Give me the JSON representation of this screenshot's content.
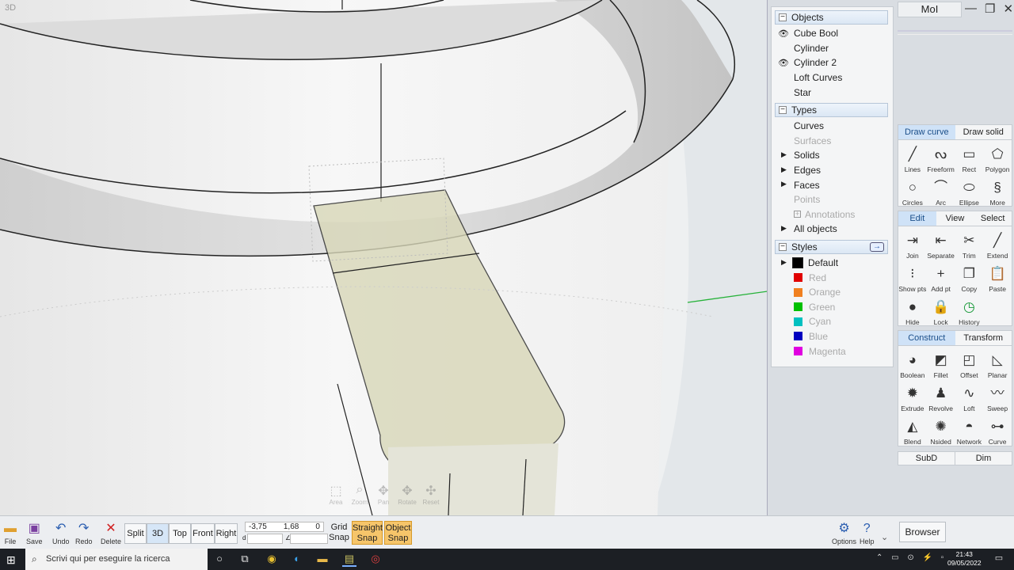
{
  "viewport": {
    "label": "3D",
    "nav_buttons": [
      "Area",
      "Zoom",
      "Pan",
      "Rotate",
      "Reset"
    ]
  },
  "scene": {
    "objects_header": "Objects",
    "objects": [
      {
        "name": "Cube Bool",
        "visible": true
      },
      {
        "name": "Cylinder",
        "visible": false
      },
      {
        "name": "Cylinder 2",
        "visible": true
      },
      {
        "name": "Loft Curves",
        "visible": false
      },
      {
        "name": "Star",
        "visible": false
      }
    ],
    "types_header": "Types",
    "types": [
      "Curves",
      "Surfaces",
      "Solids",
      "Edges",
      "Faces",
      "Points",
      "Annotations",
      "All objects"
    ],
    "styles_header": "Styles",
    "styles": [
      {
        "name": "Default",
        "color": "#000000"
      },
      {
        "name": "Red",
        "color": "#e00000"
      },
      {
        "name": "Orange",
        "color": "#f08020"
      },
      {
        "name": "Green",
        "color": "#00c000"
      },
      {
        "name": "Cyan",
        "color": "#00c0c0"
      },
      {
        "name": "Blue",
        "color": "#0000c0"
      },
      {
        "name": "Magenta",
        "color": "#e000e0"
      }
    ]
  },
  "app": {
    "title": "MoI",
    "min_icon": "minimize-icon",
    "max_icon": "restore-icon",
    "close_icon": "close-icon"
  },
  "draw": {
    "tabs": [
      "Draw curve",
      "Draw solid"
    ],
    "tools": [
      "Lines",
      "Freeform",
      "Rect",
      "Polygon",
      "Circles",
      "Arc",
      "Ellipse",
      "More"
    ]
  },
  "edit": {
    "tabs": [
      "Edit",
      "View",
      "Select"
    ],
    "tools": [
      "Join",
      "Separate",
      "Trim",
      "Extend",
      "Show pts",
      "Add pt",
      "Copy",
      "Paste",
      "Hide",
      "Lock",
      "History"
    ]
  },
  "construct": {
    "tabs": [
      "Construct",
      "Transform"
    ],
    "tools": [
      "Boolean",
      "Fillet",
      "Offset",
      "Planar",
      "Extrude",
      "Revolve",
      "Loft",
      "Sweep",
      "Blend",
      "Nsided",
      "Network",
      "Curve"
    ]
  },
  "subd": {
    "left": "SubD",
    "right": "Dim"
  },
  "bottom": {
    "file": "File",
    "save": "Save",
    "undo": "Undo",
    "redo": "Redo",
    "delete": "Delete",
    "views": [
      "Split",
      "3D",
      "Top",
      "Front",
      "Right"
    ],
    "coords": {
      "x": "-3,75",
      "y": "1,68",
      "z": "0",
      "d": "d",
      "a": "∠"
    },
    "grid_snap": "Grid\nSnap",
    "straight_snap": "Straight\nSnap",
    "object_snap": "Object\nSnap",
    "options": "Options",
    "help": "Help",
    "browser": "Browser"
  },
  "taskbar": {
    "search_placeholder": "Scrivi qui per eseguire la ricerca",
    "time": "21:43",
    "date": "09/05/2022"
  }
}
